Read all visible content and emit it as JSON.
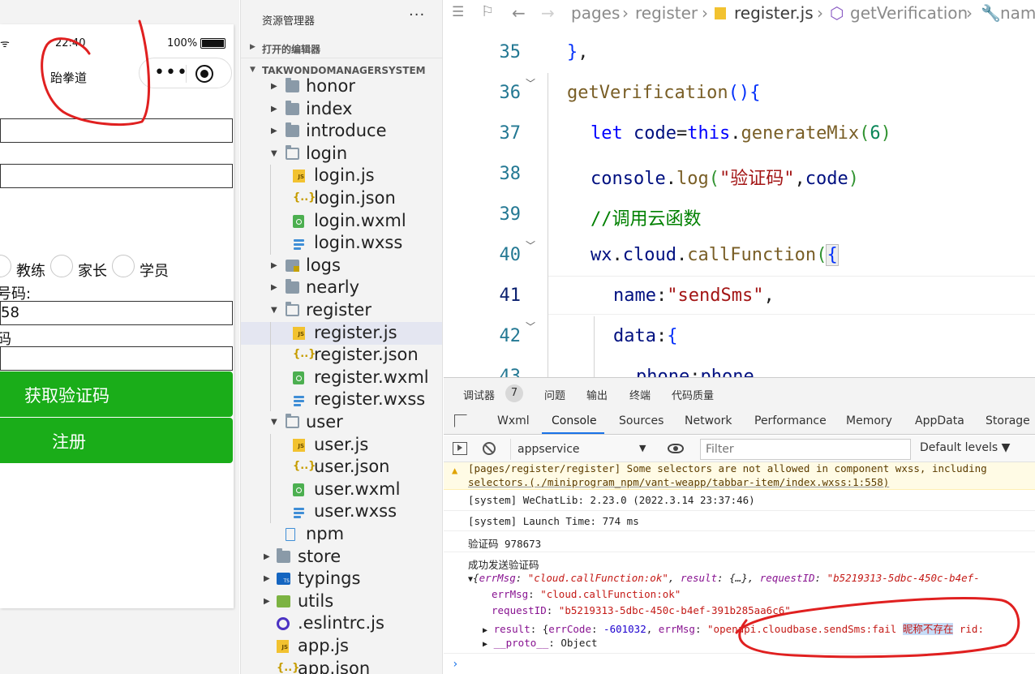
{
  "simulator": {
    "status": {
      "time": "22:40",
      "battery": "100%"
    },
    "nav_title": "跆拳道",
    "radios": [
      "教练",
      "家长",
      "学员"
    ],
    "phone_label": "号码:",
    "phone_value": "58",
    "code_label": "码",
    "get_code_label": "获取验证码",
    "register_label": "注册"
  },
  "explorer": {
    "title": "资源管理器",
    "more": "···",
    "open_editors": "打开的编辑器",
    "project": "TAKWONDOMANAGERSYSTEM",
    "tree": [
      {
        "name": "honor",
        "type": "folder",
        "depth": 0,
        "open": false
      },
      {
        "name": "index",
        "type": "folder",
        "depth": 0,
        "open": false
      },
      {
        "name": "introduce",
        "type": "folder",
        "depth": 0,
        "open": false
      },
      {
        "name": "login",
        "type": "folder",
        "depth": 0,
        "open": true
      },
      {
        "name": "login.js",
        "type": "js",
        "depth": 1
      },
      {
        "name": "login.json",
        "type": "json",
        "depth": 1
      },
      {
        "name": "login.wxml",
        "type": "wxml",
        "depth": 1
      },
      {
        "name": "login.wxss",
        "type": "wxss",
        "depth": 1
      },
      {
        "name": "logs",
        "type": "logs",
        "depth": 0,
        "open": false
      },
      {
        "name": "nearly",
        "type": "folder",
        "depth": 0,
        "open": false
      },
      {
        "name": "register",
        "type": "folder",
        "depth": 0,
        "open": true
      },
      {
        "name": "register.js",
        "type": "js",
        "depth": 1,
        "selected": true
      },
      {
        "name": "register.json",
        "type": "json",
        "depth": 1
      },
      {
        "name": "register.wxml",
        "type": "wxml",
        "depth": 1
      },
      {
        "name": "register.wxss",
        "type": "wxss",
        "depth": 1
      },
      {
        "name": "user",
        "type": "folder",
        "depth": 0,
        "open": true
      },
      {
        "name": "user.js",
        "type": "js",
        "depth": 1
      },
      {
        "name": "user.json",
        "type": "json",
        "depth": 1
      },
      {
        "name": "user.wxml",
        "type": "wxml",
        "depth": 1
      },
      {
        "name": "user.wxss",
        "type": "wxss",
        "depth": 1
      },
      {
        "name": "npm",
        "type": "npm",
        "depth": 0
      },
      {
        "name": "store",
        "type": "folder",
        "depth": -1,
        "open": false
      },
      {
        "name": "typings",
        "type": "ts",
        "depth": -1,
        "open": false
      },
      {
        "name": "utils",
        "type": "green",
        "depth": -1,
        "open": false
      },
      {
        "name": ".eslintrc.js",
        "type": "eslint",
        "depth": -1
      },
      {
        "name": "app.js",
        "type": "js",
        "depth": -1
      },
      {
        "name": "app.json",
        "type": "json",
        "depth": -1
      }
    ]
  },
  "editor": {
    "breadcrumb": [
      "pages",
      "register",
      "register.js",
      "getVerification",
      "nam"
    ],
    "lines": [
      "35",
      "36",
      "37",
      "38",
      "39",
      "40",
      "41",
      "42",
      "43"
    ]
  },
  "devtools": {
    "top_tabs": [
      "调试器",
      "问题",
      "输出",
      "终端",
      "代码质量"
    ],
    "badge": "7",
    "tabs": [
      "Wxml",
      "Console",
      "Sources",
      "Network",
      "Performance",
      "Memory",
      "AppData",
      "Storage"
    ],
    "context": "appservice",
    "filter_placeholder": "Filter",
    "levels": "Default levels ▼",
    "console": {
      "warn1": "[pages/register/register] Some selectors are not allowed in component wxss, including",
      "warn2": "selectors.(./miniprogram_npm/vant-weapp/tabbar-item/index.wxss:1:558)",
      "sys1": "[system] WeChatLib: 2.23.0 (2022.3.14 23:37:46)",
      "sys2": "[system] Launch Time: 774 ms",
      "code_log": "验证码 978673",
      "success": "成功发送验证码"
    }
  },
  "colors": {
    "green_button": "#1aad19",
    "annotation": "#e02020",
    "accent": "#1a73e8"
  }
}
